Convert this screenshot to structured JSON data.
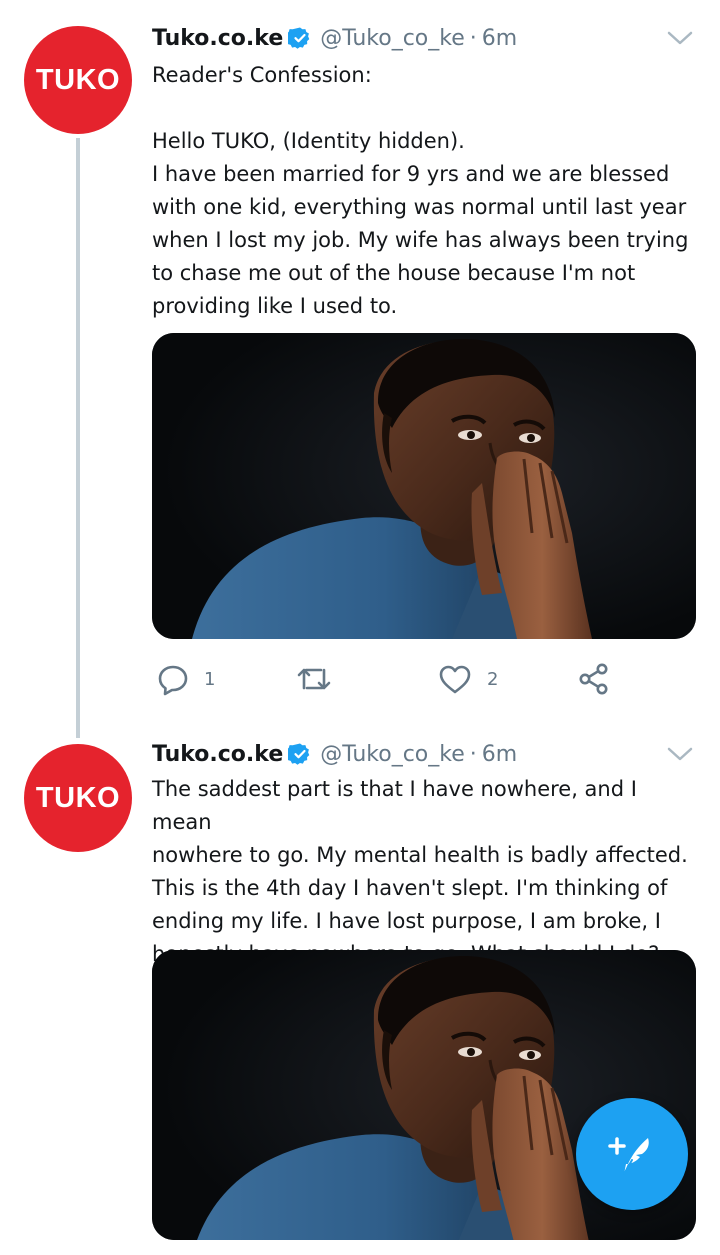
{
  "colors": {
    "brand_red": "#e5232d",
    "twitter_blue": "#1da1f2",
    "secondary_text": "#657786"
  },
  "tweets": [
    {
      "avatar_text": "TUKO",
      "name": "Tuko.co.ke",
      "handle": "@Tuko_co_ke",
      "separator": "·",
      "time": "6m",
      "text": "Reader's Confession:\n\nHello TUKO, (Identity hidden).\nI have been married for 9 yrs and we are blessed\nwith one kid, everything was normal until last year\nwhen I lost my job. My wife has always been trying\nto chase me out of the house because I'm not\nproviding like I used to.",
      "media_icon": "photo-man-praying-hands",
      "reply_count": "1",
      "retweet_count": "",
      "like_count": "2"
    },
    {
      "avatar_text": "TUKO",
      "name": "Tuko.co.ke",
      "handle": "@Tuko_co_ke",
      "separator": "·",
      "time": "6m",
      "text": "The saddest part is that I have nowhere, and I mean\nnowhere to go. My mental health is badly affected.\nThis is the 4th day I haven't slept. I'm thinking of\nending my life. I have lost purpose, I am broke, I\nhonestly have nowhere to go. What should I do?",
      "media_icon": "photo-man-praying-hands"
    }
  ],
  "icons": {
    "reply": "reply-icon",
    "retweet": "retweet-icon",
    "like": "heart-icon",
    "share": "share-icon",
    "compose": "compose-tweet-icon",
    "verified": "verified-badge-icon",
    "menu": "chevron-down-icon"
  }
}
